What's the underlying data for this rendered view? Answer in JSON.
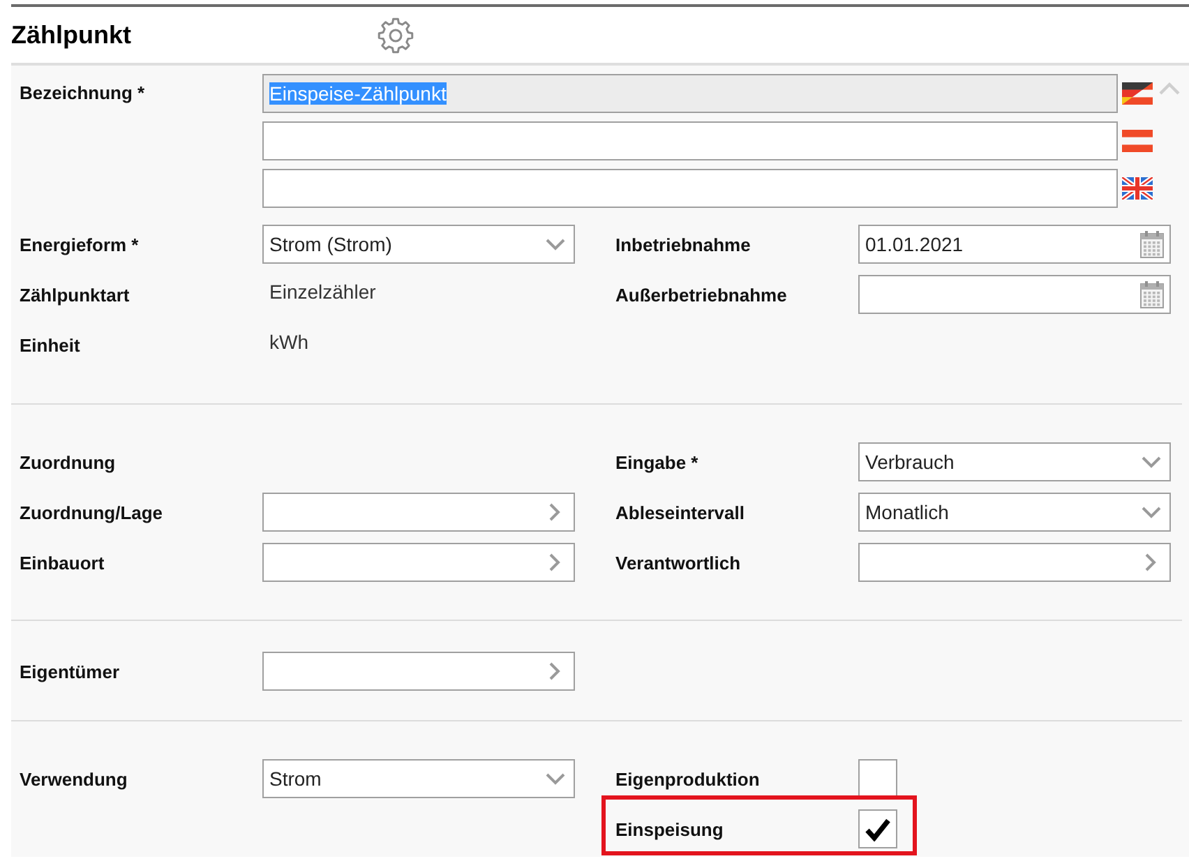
{
  "header": {
    "title": "Zählpunkt"
  },
  "name_field": {
    "label": "Bezeichnung *",
    "translations": [
      {
        "value": "Einspeise-Zählpunkt",
        "readonly": true,
        "text_selected": true
      },
      {
        "readonly": false
      },
      {
        "readonly": false
      }
    ]
  },
  "sections": [
    {
      "rows": [
        {
          "left": {
            "label": "Energieform *",
            "kind": "select",
            "value": "Strom (Strom)"
          },
          "right": {
            "label": "Inbetriebnahme",
            "kind": "date",
            "value": "01.01.2021"
          }
        },
        {
          "left": {
            "label": "Zählpunktart",
            "kind": "static",
            "value": "Einzelzähler"
          },
          "right": {
            "label": "Außerbetriebnahme",
            "kind": "date"
          }
        },
        {
          "left": {
            "label": "Einheit",
            "kind": "static",
            "value": "kWh"
          }
        }
      ]
    },
    {
      "rows": [
        {
          "left": {
            "label": "Zuordnung",
            "kind": "label"
          },
          "right": {
            "label": "Eingabe *",
            "kind": "select",
            "value": "Verbrauch"
          }
        },
        {
          "left": {
            "label": "Zuordnung/Lage",
            "kind": "lookup"
          },
          "right": {
            "label": "Ableseintervall",
            "kind": "select",
            "value": "Monatlich"
          }
        },
        {
          "left": {
            "label": "Einbauort",
            "kind": "lookup"
          },
          "right": {
            "label": "Verantwortlich",
            "kind": "lookup"
          }
        }
      ]
    },
    {
      "rows": [
        {
          "left": {
            "label": "Eigentümer",
            "kind": "lookup"
          }
        }
      ]
    },
    {
      "rows": [
        {
          "left": {
            "label": "Verwendung",
            "kind": "select",
            "value": "Strom"
          },
          "right": {
            "label": "Eigenproduktion",
            "kind": "checkbox",
            "checked": false,
            "highlighted": false
          }
        },
        {
          "right": {
            "label": "Einspeisung",
            "kind": "checkbox",
            "checked": true,
            "highlighted": true
          }
        }
      ]
    }
  ]
}
